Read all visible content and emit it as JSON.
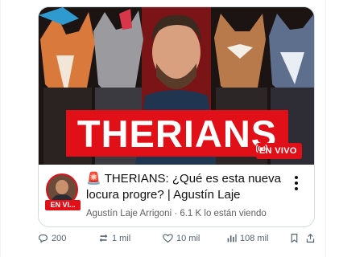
{
  "card": {
    "thumbnail": {
      "banner_text": "THERIANS",
      "live_badge": "EN VIVO"
    },
    "channel": {
      "avatar_live_label": "EN VI..."
    },
    "title_icon": "siren-emoji",
    "title": "THERIANS: ¿Qué es esta nueva locura progre? | Agustín Laje",
    "meta": "Agustín Laje Arrigoni · 6.1 K lo están viendo"
  },
  "actions": {
    "replies": "200",
    "reposts": "1 mil",
    "likes": "10 mil",
    "views": "108 mil"
  },
  "colors": {
    "brand_red": "#e10f17",
    "muted": "#536471"
  }
}
